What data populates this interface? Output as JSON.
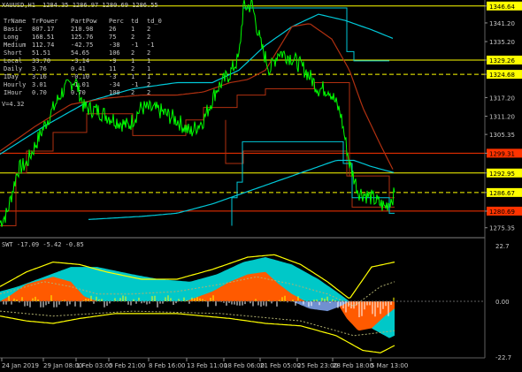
{
  "window": {
    "symbol_line": "XAUUSD,H1",
    "ohlc": "1284.35 1286.97 1280.69 1286.55"
  },
  "table": {
    "headers": [
      "TrName",
      "TrPower",
      "PartPow",
      "Perc",
      "td",
      "td_0"
    ],
    "rows": [
      [
        "Basic",
        "807.17",
        "210.98",
        "26",
        "1",
        "2"
      ],
      [
        "Long",
        "168.51",
        "125.76",
        "75",
        "2",
        "2"
      ],
      [
        "Medium",
        "112.74",
        "-42.75",
        "-38",
        "-1",
        "-1"
      ],
      [
        "Short",
        "51.51",
        "54.65",
        "106",
        "2",
        "2"
      ],
      [
        "Local",
        "33.70",
        "-3.14",
        "-9",
        "1",
        "1"
      ],
      [
        "Daily",
        "3.76",
        "0.41",
        "11",
        "2",
        "1"
      ],
      [
        "IDay",
        "3.16",
        "-0.10",
        "-3",
        "1",
        "1"
      ],
      [
        "Hourly",
        "3.01",
        "-1.01",
        "-34",
        "-1",
        "2"
      ],
      [
        "IHour",
        "0.70",
        "0.70",
        "100",
        "2",
        "2"
      ]
    ],
    "footer": "V=4.32"
  },
  "price_scale": [
    "1346.64",
    "1341.20",
    "1335.20",
    "1329.26",
    "1324.68",
    "1317.20",
    "1311.20",
    "1305.35",
    "1299.31",
    "1292.95",
    "1286.67",
    "1280.69",
    "1275.35"
  ],
  "highlighted_levels": [
    {
      "label": "1346.64",
      "color": "#ffff00"
    },
    {
      "label": "1329.26",
      "color": "#ffff00"
    },
    {
      "label": "1324.68",
      "color": "#ffff00"
    },
    {
      "label": "1299.31",
      "color": "#ff3300"
    },
    {
      "label": "1292.95",
      "color": "#ffff00"
    },
    {
      "label": "1286.67",
      "color": "#ffff00"
    },
    {
      "label": "1280.69",
      "color": "#ff3300"
    }
  ],
  "indicator": {
    "title": "SWT -17.09 -5.42 -0.85",
    "scale": [
      "22.7",
      "0.00",
      "-22.7"
    ]
  },
  "time_axis": [
    "24 Jan 2019",
    "29 Jan 08:00",
    "1 Feb 03:00",
    "5 Feb 21:00",
    "8 Feb 16:00",
    "13 Feb 11:00",
    "18 Feb 06:00",
    "21 Feb 05:00",
    "25 Feb 23:00",
    "28 Feb 18:00",
    "5 Mar 13:00"
  ],
  "colors": {
    "background": "#000000",
    "price_line": "#00ff00",
    "level_yellow": "#ffff00",
    "level_red": "#ff3300",
    "ma_cyan": "#00c8d8",
    "ma_red": "#b03010",
    "osc_cyan": "#00c8c8",
    "osc_orange": "#ff5a00",
    "osc_blue": "#7090d0",
    "osc_yellow": "#ffff00"
  }
}
